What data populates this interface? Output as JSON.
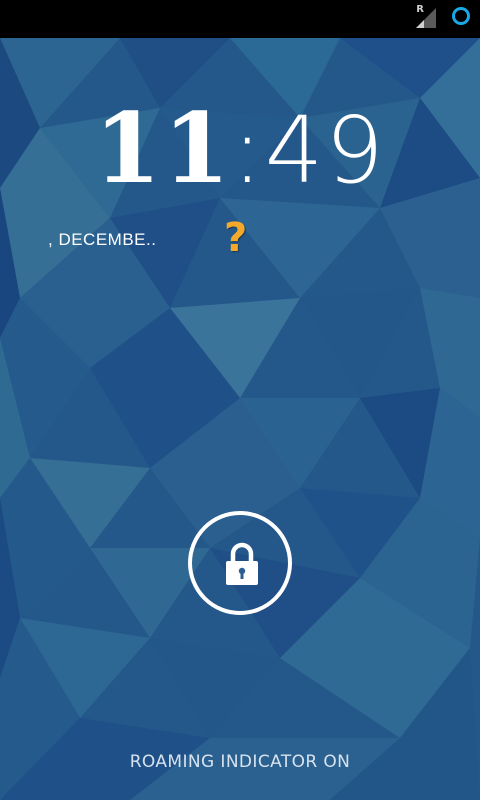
{
  "status_bar": {
    "roaming_indicator": "R",
    "signal_icon": "signal-roaming-icon",
    "sync_icon": "sync-ring-icon",
    "accent_color": "#1aa8e6"
  },
  "lockscreen": {
    "clock": {
      "hours": "11",
      "colon": ":",
      "minutes": "49"
    },
    "date_text": ", DECEMBE..",
    "weather": {
      "symbol": "?",
      "icon": "unknown-weather-icon",
      "color": "#f4a92b"
    },
    "unlock": {
      "icon": "lock-icon"
    },
    "footer_text": "ROAMING INDICATOR ON"
  }
}
